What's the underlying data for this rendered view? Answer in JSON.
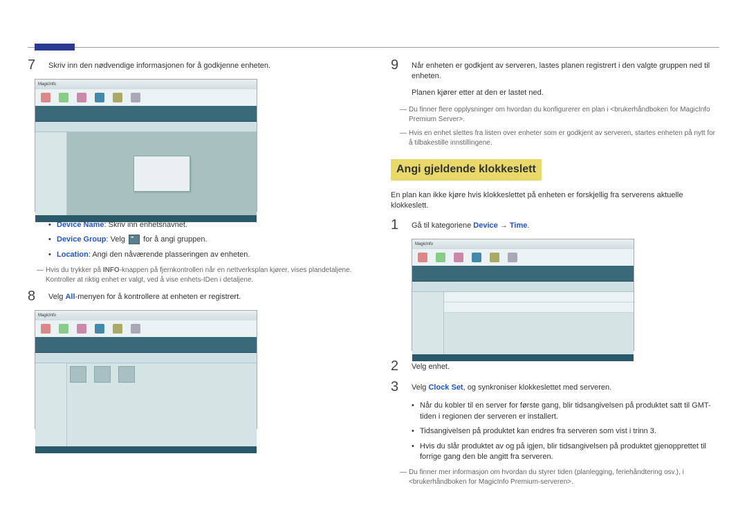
{
  "left": {
    "step7": {
      "num": "7",
      "text": "Skriv inn den nødvendige informasjonen for å godkjenne enheten."
    },
    "screenshot1_title": "MagicInfo",
    "bullets": {
      "b1a": "Device Name",
      "b1b": ": Skriv inn enhetsnavnet.",
      "b2a": "Device Group",
      "b2b": ": Velg ",
      "b2c": " for å angi gruppen.",
      "b3a": "Location",
      "b3b": ": Angi den nåværende plasseringen av enheten."
    },
    "note_info": {
      "a": "Hvis du trykker på ",
      "b": "INFO",
      "c": "-knappen på fjernkontrollen når en nettverksplan kjører, vises plandetaljene. Kontroller at riktig enhet er valgt, ved å vise enhets-IDen i detaljene."
    },
    "step8": {
      "num": "8",
      "a": "Velg ",
      "b": "All",
      "c": "-menyen for å kontrollere at enheten er registrert."
    }
  },
  "right": {
    "step9": {
      "num": "9",
      "line1": "Når enheten er godkjent av serveren, lastes planen registrert i den valgte gruppen ned til enheten.",
      "line2": "Planen kjører etter at den er lastet ned."
    },
    "note_a": "Du finner flere opplysninger om hvordan du konfigurerer en plan i <brukerhåndboken for MagicInfo Premium Server>.",
    "note_b": "Hvis en enhet slettes fra listen over enheter som er godkjent av serveren, startes enheten på nytt for å tilbakestille innstillingene.",
    "section_title": "Angi gjeldende klokkeslett",
    "intro": "En plan kan ikke kjøre hvis klokkeslettet på enheten er forskjellig fra serverens aktuelle klokkeslett.",
    "step1": {
      "num": "1",
      "a": "Gå til kategoriene ",
      "b": "Device",
      "arrow": " → ",
      "c": "Time",
      "d": "."
    },
    "step2": {
      "num": "2",
      "text": "Velg enhet."
    },
    "step3": {
      "num": "3",
      "a": "Velg ",
      "b": "Clock Set",
      "c": ", og synkroniser klokkeslettet med serveren."
    },
    "sub_bullets": {
      "s1": "Når du kobler til en server for første gang, blir tidsangivelsen på produktet satt til GMT-tiden i regionen der serveren er installert.",
      "s2": "Tidsangivelsen på produktet kan endres fra serveren som vist i trinn 3.",
      "s3": "Hvis du slår produktet av og på igjen, blir tidsangivelsen på produktet gjenopprettet til forrige gang den ble angitt fra serveren."
    },
    "note_c": "Du finner mer informasjon om hvordan du styrer tiden (planlegging, feriehåndtering osv.), i <brukerhåndboken for MagicInfo Premium-serveren>."
  }
}
